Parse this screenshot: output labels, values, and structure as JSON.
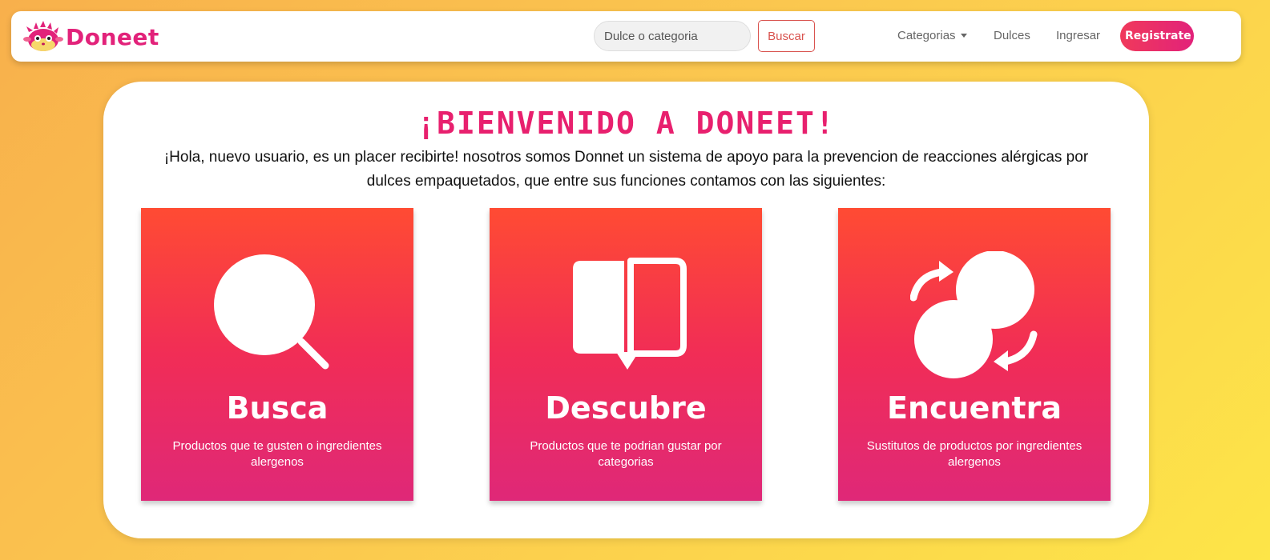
{
  "navbar": {
    "brand_name": "Doneet",
    "search_placeholder": "Dulce o categoria",
    "search_button": "Buscar",
    "links": {
      "categorias": "Categorias",
      "dulces": "Dulces",
      "ingresar": "Ingresar"
    },
    "register_button": "Registrate"
  },
  "welcome": {
    "title": "¡BIENVENIDO A DONEET!",
    "text": "¡Hola, nuevo usuario, es un placer recibirte! nosotros somos Donnet un sistema de apoyo para la prevencion de reacciones alérgicas por dulces empaquetados, que entre sus funciones contamos con las siguientes:"
  },
  "features": [
    {
      "icon": "search-icon",
      "title": "Busca",
      "description": "Productos que te gusten o ingredientes alergenos"
    },
    {
      "icon": "open-book-icon",
      "title": "Descubre",
      "description": "Productos que te podrian gustar por categorias"
    },
    {
      "icon": "swap-circles-icon",
      "title": "Encuentra",
      "description": "Sustitutos de productos por ingredientes alergenos"
    }
  ],
  "colors": {
    "brand": "#e2227a",
    "title_pink": "#e8206e",
    "card_gradient_top": "#ff4b33",
    "card_gradient_bottom": "#df2878",
    "search_button_red": "#d9534f"
  }
}
